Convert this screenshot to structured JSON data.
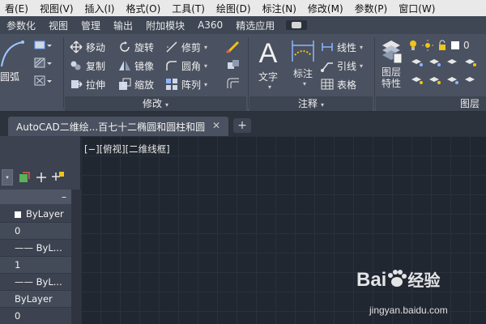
{
  "menu": [
    "看(E)",
    "视图(V)",
    "插入(I)",
    "格式(O)",
    "工具(T)",
    "绘图(D)",
    "标注(N)",
    "修改(M)",
    "参数(P)",
    "窗口(W)"
  ],
  "ribbon_tabs": [
    "参数化",
    "视图",
    "管理",
    "输出",
    "附加模块",
    "A360",
    "精选应用"
  ],
  "ribbon": {
    "draw_partial": "圆弧",
    "modify": {
      "col1": [
        "移动",
        "复制",
        "拉伸"
      ],
      "col2": [
        "旋转",
        "镜像",
        "缩放"
      ],
      "col3": [
        "修剪",
        "圆角",
        "阵列"
      ],
      "panel_title": "修改"
    },
    "annotation": {
      "text_label": "文字",
      "dim_label": "标注",
      "small": [
        "线性",
        "引线",
        "表格"
      ],
      "panel_title": "注释"
    },
    "layers": {
      "props_label_1": "图层",
      "props_label_2": "特性",
      "layer_number": "0",
      "panel_title": "图层"
    }
  },
  "doc_tab": {
    "title": "AutoCAD二维绘...百七十二椭圆和圆柱和圆",
    "close": "✕"
  },
  "new_tab": "+",
  "palette": {
    "header_symbol": "–",
    "rows": [
      "ByLayer",
      "0",
      "—— ByL...",
      "1",
      "—— ByL...",
      "ByLayer",
      "0"
    ]
  },
  "viewport_label": "[−][俯视][二维线框]",
  "watermark": {
    "brand_left": "Bai",
    "brand_right": "经验",
    "url": "jingyan.baidu.com"
  },
  "colors": {
    "canvas": "#212731",
    "ribbon": "#4a5160",
    "menubar": "#e9e9e9",
    "accent_yellow": "#f0c419"
  }
}
